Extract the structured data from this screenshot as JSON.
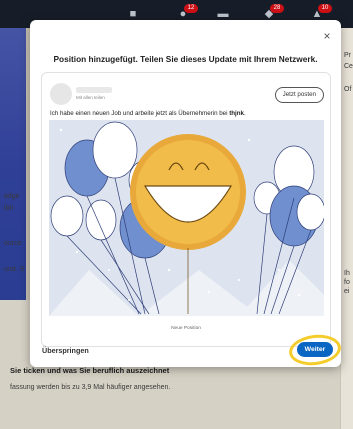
{
  "navbar": {
    "badges": [
      "",
      "12",
      "",
      "28",
      "10"
    ]
  },
  "background": {
    "right_labels": [
      "Pr",
      "Ce",
      "Of",
      "Ih",
      "fo",
      "ei"
    ],
    "left_labels": [
      "adge",
      "ibh",
      "ource",
      "und. S"
    ],
    "section_title": "Sie ticken und was Sie beruflich auszeichnet",
    "section_text": "fassung werden bis zu 3,9 Mal häufiger angesehen."
  },
  "modal": {
    "title": "Position hinzugefügt. Teilen Sie dieses Update mit Ihrem Netzwerk.",
    "close_label": "×",
    "post": {
      "visibility": "Mit allen teilen",
      "post_now_label": "Jetzt posten",
      "text_prefix": "Ich habe einen neuen Job und arbeite jetzt als Übernehmerin bei ",
      "company": "thjnk",
      "text_suffix": ".",
      "image_caption": "Neue Position"
    },
    "skip_label": "Überspringen",
    "next_label": "Weiter"
  },
  "colors": {
    "primary": "#0a66c2",
    "highlight": "#f4cc2b",
    "badge": "#cc1016"
  }
}
